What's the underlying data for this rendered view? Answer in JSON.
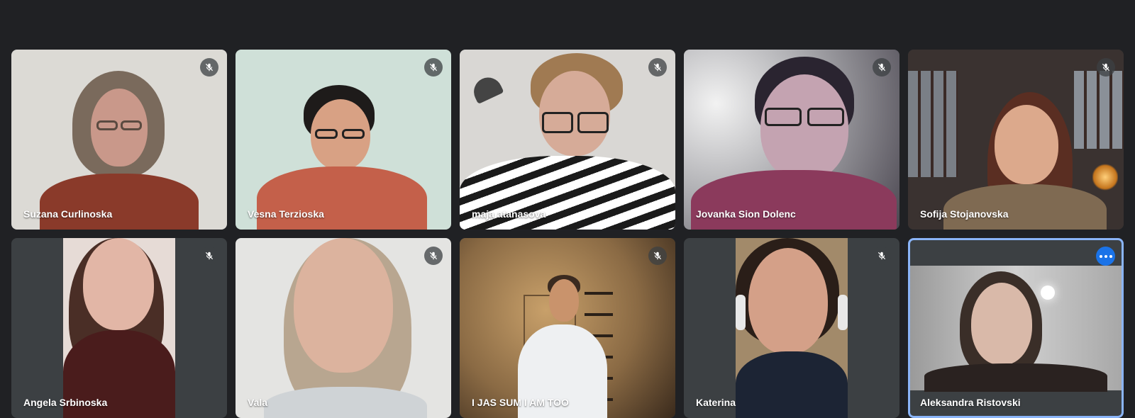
{
  "participants": [
    {
      "name": "Suzana Curlinoska",
      "mic": "muted",
      "colors": {
        "bg": "#dcdad5",
        "skin": "#c9988a",
        "hair": "#7a6a5c",
        "top": "#8a3a2a"
      }
    },
    {
      "name": "Vesna Terzioska",
      "mic": "muted",
      "colors": {
        "bg": "#cfe0d8",
        "skin": "#d8a184",
        "hair": "#1e1b1a",
        "top": "#c4604a"
      }
    },
    {
      "name": "maja atanasova",
      "mic": "muted",
      "colors": {
        "bg": "#d9d7d4",
        "skin": "#d6ab98",
        "hair": "#a07a52",
        "top": "#ffffff"
      }
    },
    {
      "name": "Jovanka Sion Dolenc",
      "mic": "muted",
      "colors": {
        "bg": "#a9a9ad",
        "skin": "#c4a3b1",
        "hair": "#2a2430",
        "top": "#8b3a5c"
      }
    },
    {
      "name": "Sofija Stojanovska",
      "mic": "muted",
      "colors": {
        "bg": "#3a3230",
        "skin": "#dca98c",
        "hair": "#5a2e22",
        "top": "#7f6a52"
      }
    },
    {
      "name": "Angela Srbinoska",
      "mic": "muted",
      "colors": {
        "bg": "#e6dbd6",
        "skin": "#e2b6a6",
        "hair": "#4a2e26",
        "top": "#4a1c1c"
      }
    },
    {
      "name": "Vala",
      "mic": "muted",
      "colors": {
        "bg": "#e4e4e2",
        "skin": "#dcb39e",
        "hair": "#b8a690",
        "top": "#cfd3d6"
      }
    },
    {
      "name": "I JAS SUM I AM TOO",
      "mic": "muted",
      "colors": {
        "bg": "#8a6a44",
        "skin": "#c9936c",
        "hair": "#3a2a20",
        "top": "#eef0f2"
      }
    },
    {
      "name": "Katerina",
      "mic": "muted",
      "colors": {
        "bg": "#a28a6a",
        "skin": "#d4a088",
        "hair": "#2a1e18",
        "top": "#1c2434"
      }
    },
    {
      "name": "Aleksandra Ristovski",
      "mic": "active",
      "colors": {
        "bg": "#b5b5b5",
        "skin": "#d9b9a9",
        "hair": "#3a2e28",
        "top": "#2a2220"
      }
    }
  ],
  "icons": {
    "muted": "mic-off-icon",
    "more": "more-options-icon"
  },
  "accent": "#8ab4f8"
}
